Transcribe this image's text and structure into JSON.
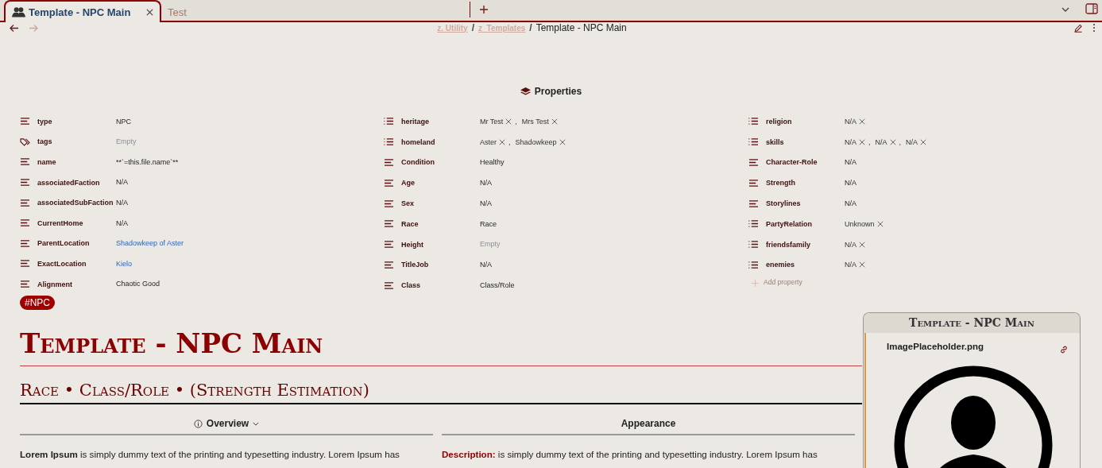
{
  "tabs": [
    {
      "label": "Template - NPC Main",
      "selected": true
    },
    {
      "label": "Test",
      "selected": false
    }
  ],
  "breadcrumb": {
    "folders": [
      "z. Utility",
      "z_Templates"
    ],
    "separator": "/",
    "current": "Template - NPC Main"
  },
  "properties": {
    "title": "Properties",
    "separator": ",",
    "add_label": "Add property",
    "columns": [
      [
        {
          "key": "type",
          "kind": "text",
          "value": "NPC",
          "is_empty": false,
          "is_link": false
        },
        {
          "key": "tags",
          "kind": "tags",
          "value": "Empty",
          "is_empty": true,
          "is_link": false
        },
        {
          "key": "name",
          "kind": "text",
          "value": "**`=this.file.name`**",
          "is_empty": false,
          "is_link": false
        },
        {
          "key": "associatedFaction",
          "kind": "text",
          "value": "N/A",
          "is_empty": false,
          "is_link": false
        },
        {
          "key": "associatedSubFaction",
          "kind": "text",
          "value": "N/A",
          "is_empty": false,
          "is_link": false
        },
        {
          "key": "CurrentHome",
          "kind": "text",
          "value": "N/A",
          "is_empty": false,
          "is_link": false
        },
        {
          "key": "ParentLocation",
          "kind": "text",
          "value": "Shadowkeep of Aster",
          "is_empty": false,
          "is_link": true
        },
        {
          "key": "ExactLocation",
          "kind": "text",
          "value": "Kielo",
          "is_empty": false,
          "is_link": true
        },
        {
          "key": "Alignment",
          "kind": "text",
          "value": "Chaotic Good",
          "is_empty": false,
          "is_link": false
        }
      ],
      [
        {
          "key": "heritage",
          "kind": "list",
          "values": [
            "Mr Test",
            "Mrs Test"
          ]
        },
        {
          "key": "homeland",
          "kind": "list",
          "values": [
            "Aster",
            "Shadowkeep"
          ]
        },
        {
          "key": "Condition",
          "kind": "text",
          "value": "Healthy",
          "is_empty": false,
          "is_link": false
        },
        {
          "key": "Age",
          "kind": "text",
          "value": "N/A",
          "is_empty": false,
          "is_link": false
        },
        {
          "key": "Sex",
          "kind": "text",
          "value": "N/A",
          "is_empty": false,
          "is_link": false
        },
        {
          "key": "Race",
          "kind": "text",
          "value": "Race",
          "is_empty": false,
          "is_link": false
        },
        {
          "key": "Height",
          "kind": "text",
          "value": "Empty",
          "is_empty": true,
          "is_link": false
        },
        {
          "key": "TitleJob",
          "kind": "text",
          "value": "N/A",
          "is_empty": false,
          "is_link": false
        },
        {
          "key": "Class",
          "kind": "text",
          "value": "Class/Role",
          "is_empty": false,
          "is_link": false
        }
      ],
      [
        {
          "key": "religion",
          "kind": "list",
          "values": [
            "N/A"
          ]
        },
        {
          "key": "skills",
          "kind": "list",
          "values": [
            "N/A",
            "N/A",
            "N/A"
          ]
        },
        {
          "key": "Character-Role",
          "kind": "text",
          "value": "N/A",
          "is_empty": false,
          "is_link": false
        },
        {
          "key": "Strength",
          "kind": "text",
          "value": "N/A",
          "is_empty": false,
          "is_link": false
        },
        {
          "key": "Storylines",
          "kind": "text",
          "value": "N/A",
          "is_empty": false,
          "is_link": false
        },
        {
          "key": "PartyRelation",
          "kind": "list",
          "values": [
            "Unknown"
          ]
        },
        {
          "key": "friendsfamily",
          "kind": "list",
          "values": [
            "N/A"
          ]
        },
        {
          "key": "enemies",
          "kind": "list",
          "values": [
            "N/A"
          ]
        }
      ]
    ]
  },
  "tag": "#NPC",
  "title": "Template - NPC Main",
  "subtitle": "Race • Class/Role • (Strength Estimation)",
  "sections": [
    {
      "heading": "Overview",
      "expandable": true,
      "highlight_label": false,
      "text": "**Lorem Ipsum** is simply dummy text of the printing and typesetting industry. Lorem Ipsum has"
    },
    {
      "heading": "Appearance",
      "expandable": false,
      "highlight_label": true,
      "text": "**Description:** is simply dummy text of the printing and typesetting industry. Lorem Ipsum has"
    }
  ],
  "infobox": {
    "title": "Template - NPC Main",
    "image_name": "ImagePlaceholder.png"
  }
}
